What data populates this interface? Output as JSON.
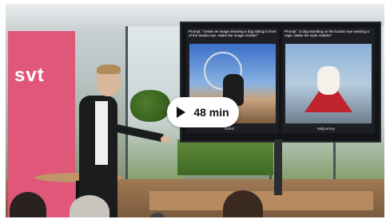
{
  "banner": {
    "text": "svt"
  },
  "slide": {
    "left_prompt": "Prompt: \"create an image showing a dog sitting in front of the london eye. Make the image realistic\"",
    "left_caption": "Dall-E",
    "right_prompt": "Prompt: \"a dog standing on the london eye wearing a cape. Make the style realistic\"",
    "right_caption": "Midjourney"
  },
  "video": {
    "duration": "48 min",
    "play_icon": "play-icon"
  },
  "colors": {
    "banner": "#e0577a",
    "badge_bg": "#ffffff",
    "cape": "#c0242c"
  }
}
